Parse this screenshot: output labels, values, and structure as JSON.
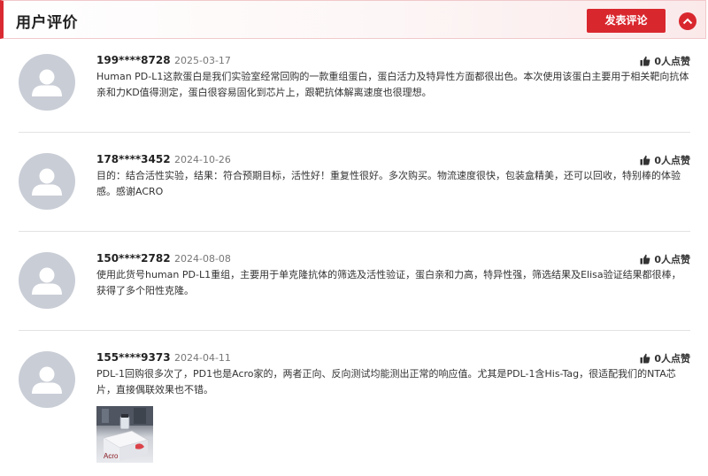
{
  "header": {
    "title": "用户评价",
    "post_label": "发表评论",
    "accent_color": "#d9272e"
  },
  "reviews": [
    {
      "user": "199****8728",
      "date": "2025-03-17",
      "likes": "0人点赞",
      "text": "Human PD-L1这款蛋白是我们实验室经常回购的一款重组蛋白，蛋白活力及特异性方面都很出色。本次使用该蛋白主要用于相关靶向抗体亲和力KD值得测定，蛋白很容易固化到芯片上，跟靶抗体解离速度也很理想。"
    },
    {
      "user": "178****3452",
      "date": "2024-10-26",
      "likes": "0人点赞",
      "text": "目的：结合活性实验，结果：符合预期目标，活性好！重复性很好。多次购买。物流速度很快，包装盒精美，还可以回收，特别棒的体验感。感谢ACRO"
    },
    {
      "user": "150****2782",
      "date": "2024-08-08",
      "likes": "0人点赞",
      "text": "使用此货号human PD-L1重组，主要用于单克隆抗体的筛选及活性验证，蛋白亲和力高，特异性强，筛选结果及Elisa验证结果都很棒，获得了多个阳性克隆。"
    },
    {
      "user": "155****9373",
      "date": "2024-04-11",
      "likes": "0人点赞",
      "text": "PDL-1回购很多次了，PD1也是Acro家的，两者正向、反向测试均能测出正常的响应值。尤其是PDL-1含His-Tag，很适配我们的NTA芯片，直接偶联效果也不错。",
      "photo_label": "Acro"
    }
  ]
}
